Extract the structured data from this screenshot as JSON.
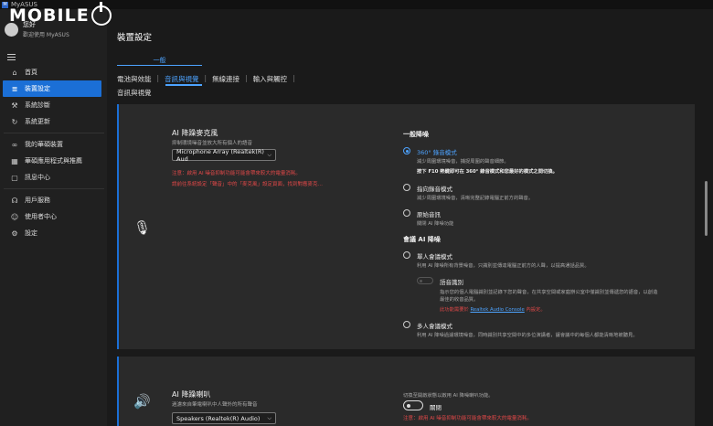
{
  "titlebar": {
    "app_name": "MyASUS"
  },
  "watermark": {
    "text": "MOBILE"
  },
  "profile": {
    "name": "您好",
    "subtitle": "歡迎使用 MyASUS"
  },
  "nav": {
    "group1": [
      {
        "label": "首頁",
        "icon": "home-icon",
        "glyph": "⌂",
        "active": false
      },
      {
        "label": "裝置設定",
        "icon": "sliders-icon",
        "glyph": "≣",
        "active": true
      },
      {
        "label": "系統診斷",
        "icon": "wrench-icon",
        "glyph": "⚒",
        "active": false
      },
      {
        "label": "系統更新",
        "icon": "refresh-icon",
        "glyph": "↻",
        "active": false
      }
    ],
    "group2": [
      {
        "label": "我的華碩裝置",
        "icon": "link-icon",
        "glyph": "∞",
        "active": false
      },
      {
        "label": "華碩應用程式與推薦",
        "icon": "grid-icon",
        "glyph": "▦",
        "active": false
      },
      {
        "label": "訊息中心",
        "icon": "message-icon",
        "glyph": "▢",
        "active": false
      }
    ],
    "group3": [
      {
        "label": "用戶服務",
        "icon": "headset-icon",
        "glyph": "☊",
        "active": false
      },
      {
        "label": "使用者中心",
        "icon": "user-icon",
        "glyph": "☺",
        "active": false
      },
      {
        "label": "設定",
        "icon": "gear-icon",
        "glyph": "⚙",
        "active": false
      }
    ]
  },
  "main": {
    "title": "裝置設定",
    "section_tab": "一般",
    "subtabs": [
      "電池與效能",
      "音訊與視覺",
      "無線連接",
      "輸入與觸控"
    ],
    "active_subtab": 1,
    "crumb": "音訊與視覺"
  },
  "mic_card": {
    "title": "AI 降躁麥克風",
    "desc": "抑制環境噪音並放大所有個人的語音",
    "select_value": "Microphone Array (Realtek(R) Aud",
    "warn1": "注意：啟用 AI 噪音抑制功能可能會帶來較大的電量消耗。",
    "warn2": "請前往系統設定「聲音」中的「麥克風」設定頁面，找到對應麥克風並將語音強化設定為「關閉」",
    "general_title": "一般降噪",
    "options": [
      {
        "label": "360° 錄音模式",
        "desc": "減少周圍環境噪音，捕捉周圍的聲音細節。",
        "desc2": "按下 F10 熱鍵即可在 360° 錄音模式和您最好的模式之間切換。"
      },
      {
        "label": "指向錄音模式",
        "desc": "減少周圍環境噪音，清晰完整記錄電腦正前方的聲音。"
      },
      {
        "label": "原始音訊",
        "desc": "關閉 AI 降噪功能"
      }
    ],
    "meeting_title": "會議 AI 降噪",
    "meeting_options": [
      {
        "label": "單人會議模式",
        "desc": "利用 AI 降噪所有背景噪音，只識別並傳達電腦正前方的人聲，以提高通話品質。"
      },
      {
        "label": "多人會議模式",
        "desc": "利用 AI 降噪過濾環境噪音，同時識別共享空間中的多位演講者，讓會議中的每個人都能清晰地被聽見。"
      }
    ],
    "voice_id": {
      "label": "語音識別",
      "desc1": "指示您的個人電腦識別並記錄下您的聲音，在共享空間或家庭辦公室中僅識別並傳遞您的語音，以創造",
      "desc2": "最佳的收音品質。",
      "red_prefix": "此功能需要於",
      "link": "Realtek Audio Console",
      "red_suffix": "內設定。"
    }
  },
  "speaker_card": {
    "title": "AI 降躁喇叭",
    "desc": "過濾來自筆電喇叭中人聲外的所有聲音",
    "select_value": "Speakers (Realtek(R) Audio)",
    "toggle_hint": "切換至開啟狀態以啟用 AI 降噪喇叭功能。",
    "toggle_label": "關閉",
    "warn": "注意：啟用 AI 噪音抑制功能可能會帶來較大的電量消耗。"
  }
}
